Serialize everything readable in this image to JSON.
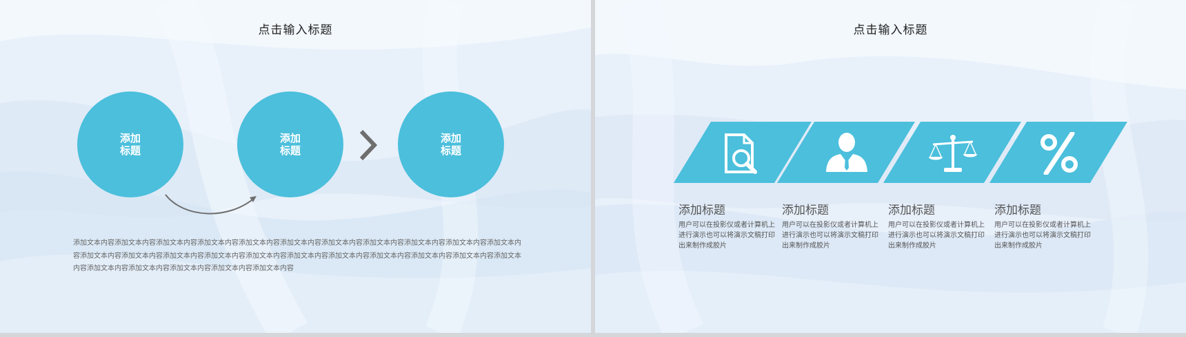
{
  "slides": [
    {
      "title": "点击输入标题",
      "circles": [
        {
          "label": "添加 标题"
        },
        {
          "label": "添加 标题"
        },
        {
          "label": "添加 标题"
        }
      ],
      "body_text": "添加文本内容添加文本内容添加文本内容添加文本内容添加文本内容添加文本内容添加文本内容添加文本内容添加文本内容添加文本内容添加文本内容添加文本内容添加文本内容添加文本内容添加文本内容添加文本内容添加文本内容添加文本内容添加文本内容添加文本内容添加文本内容添加文本内容添加文本内容添加文本内容添加文本内容添加文本内容添加文本内容"
    },
    {
      "title": "点击输入标题",
      "features": [
        {
          "icon": "search-document-icon",
          "title": "添加标题",
          "desc": "用户可以在投影仪或者计算机上进行演示也可以将演示文稿打印出来制作成胶片"
        },
        {
          "icon": "businessman-icon",
          "title": "添加标题",
          "desc": "用户可以在投影仪或者计算机上进行演示也可以将演示文稿打印出来制作成胶片"
        },
        {
          "icon": "balance-scale-icon",
          "title": "添加标题",
          "desc": "用户可以在投影仪或者计算机上进行演示也可以将演示文稿打印出来制作成胶片"
        },
        {
          "icon": "percent-icon",
          "title": "添加标题",
          "desc": "用户可以在投影仪或者计算机上进行演示也可以将演示文稿打印出来制作成胶片"
        }
      ]
    }
  ],
  "colors": {
    "accent": "#4bbfdc",
    "background": "#eaf1fa",
    "separator": "#d4d6d9"
  }
}
